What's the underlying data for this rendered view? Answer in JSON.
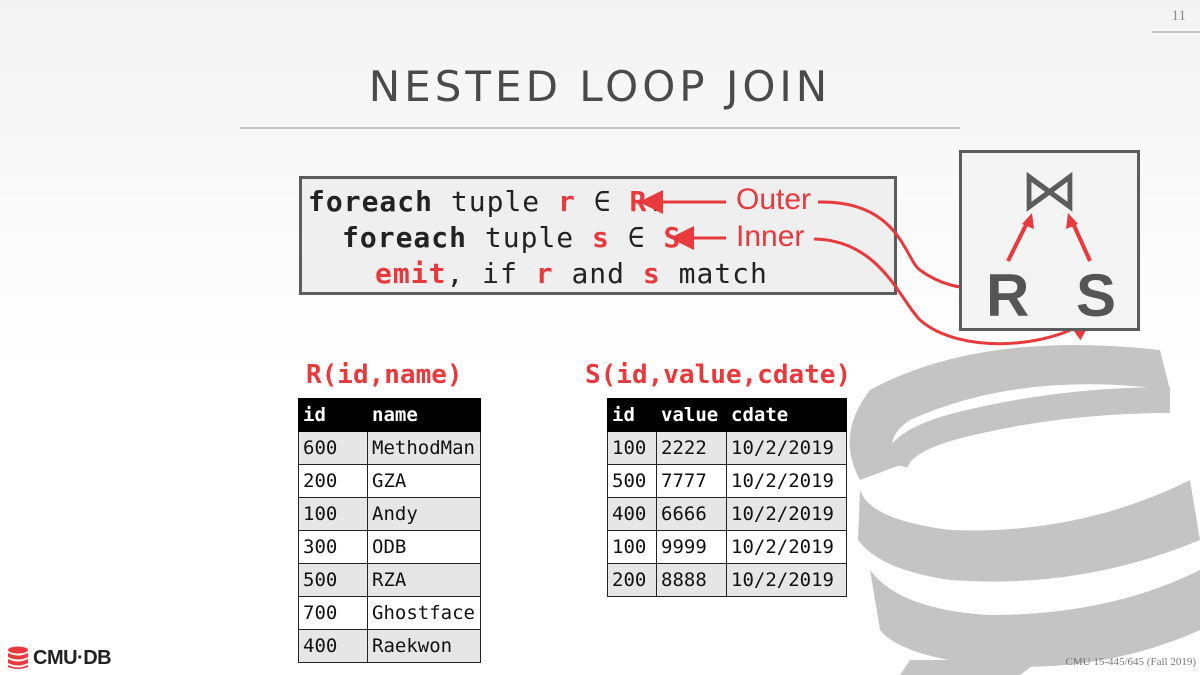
{
  "page_number": "11",
  "title": "NESTED LOOP JOIN",
  "code": {
    "line1": {
      "kw": "foreach",
      "mid": " tuple ",
      "var": "r",
      "in": " ∈ ",
      "rel": "R",
      "colon": ":"
    },
    "line2": {
      "kw": "foreach",
      "mid": " tuple ",
      "var": "s",
      "in": " ∈ ",
      "rel": "S",
      "colon": ":"
    },
    "line3": {
      "emit": "emit",
      "a": ", if ",
      "r": "r",
      "and": " and ",
      "s": "s",
      "match": " match"
    },
    "outer_label": "Outer",
    "inner_label": "Inner"
  },
  "join_diagram": {
    "symbol": "⋈",
    "left": "R",
    "right": "S"
  },
  "table_r": {
    "title": "R(id,name)",
    "columns": [
      "id",
      "name"
    ],
    "rows": [
      [
        "600",
        "MethodMan"
      ],
      [
        "200",
        "GZA"
      ],
      [
        "100",
        "Andy"
      ],
      [
        "300",
        "ODB"
      ],
      [
        "500",
        "RZA"
      ],
      [
        "700",
        "Ghostface"
      ],
      [
        "400",
        "Raekwon"
      ]
    ]
  },
  "table_s": {
    "title": "S(id,value,cdate)",
    "columns": [
      "id",
      "value",
      "cdate"
    ],
    "rows": [
      [
        "100",
        "2222",
        "10/2/2019"
      ],
      [
        "500",
        "7777",
        "10/2/2019"
      ],
      [
        "400",
        "6666",
        "10/2/2019"
      ],
      [
        "100",
        "9999",
        "10/2/2019"
      ],
      [
        "200",
        "8888",
        "10/2/2019"
      ]
    ]
  },
  "logo_text": "CMU·DB",
  "footer": "CMU 15-445/645 (Fall 2019)",
  "colors": {
    "accent": "#e8393c",
    "frame": "#5c5c5c",
    "watermark": "#c4c4c4"
  }
}
